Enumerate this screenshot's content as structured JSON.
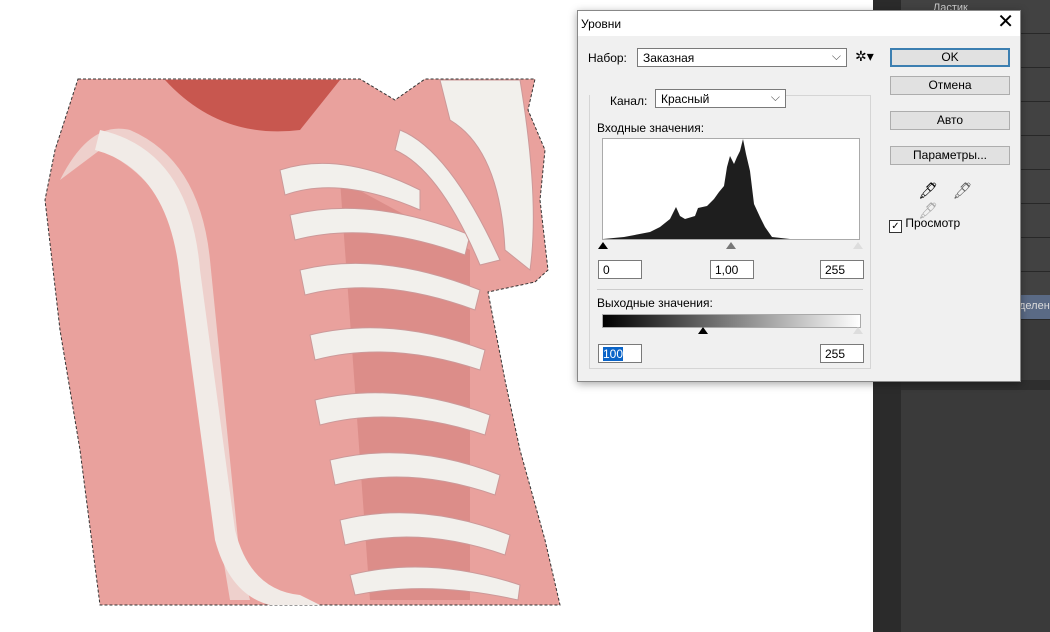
{
  "dialog": {
    "title": "Уровни",
    "close_icon": "close-icon",
    "preset_label": "Набор:",
    "preset_value": "Заказная",
    "preset_options_icon": "gear-icon",
    "channel_label": "Канал:",
    "channel_value": "Красный",
    "input_label": "Входные значения:",
    "input_black": "0",
    "input_gamma": "1,00",
    "input_white": "255",
    "output_label": "Выходные значения:",
    "output_black": "100",
    "output_white": "255",
    "buttons": {
      "ok": "OK",
      "cancel": "Отмена",
      "auto": "Авто",
      "options": "Параметры..."
    },
    "eyedroppers": [
      "black-eyedropper-icon",
      "gray-eyedropper-icon",
      "white-eyedropper-icon"
    ],
    "preview_label": "Просмотр",
    "preview_checked": true,
    "accent": "#3c7fb1"
  },
  "panel": {
    "tool_label": "Ластик",
    "selected_partial": "делени"
  }
}
